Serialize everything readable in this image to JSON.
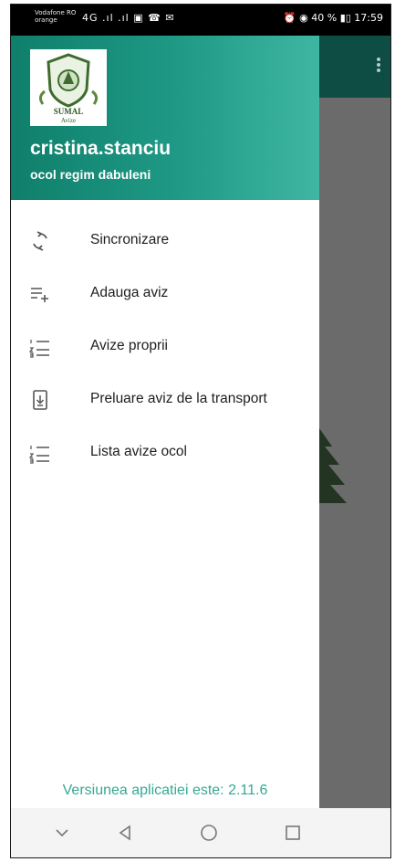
{
  "status_bar": {
    "carrier_line1": "Vodafone RO",
    "carrier_line2": "orange",
    "signal_text": "4G .ıl .ıl",
    "battery_percent": "40 %",
    "time": "17:59"
  },
  "drawer": {
    "logo_text_line1": "SUMAL",
    "logo_text_line2": "Avize",
    "user_name": "cristina.stanciu",
    "user_unit": "ocol regim dabuleni",
    "menu": [
      {
        "label": "Sincronizare",
        "icon": "sync-icon"
      },
      {
        "label": "Adauga aviz",
        "icon": "playlist-add-icon"
      },
      {
        "label": "Avize proprii",
        "icon": "numbered-list-icon"
      },
      {
        "label": "Preluare aviz de la transport",
        "icon": "phone-download-icon"
      },
      {
        "label": "Lista avize ocol",
        "icon": "numbered-list-icon"
      }
    ],
    "version_text": "Versiunea aplicatiei este: 2.11.6"
  },
  "colors": {
    "header_start": "#0f7f6b",
    "header_end": "#3fb6a2",
    "version_text": "#38a894",
    "app_bar": "#0d4d44"
  }
}
